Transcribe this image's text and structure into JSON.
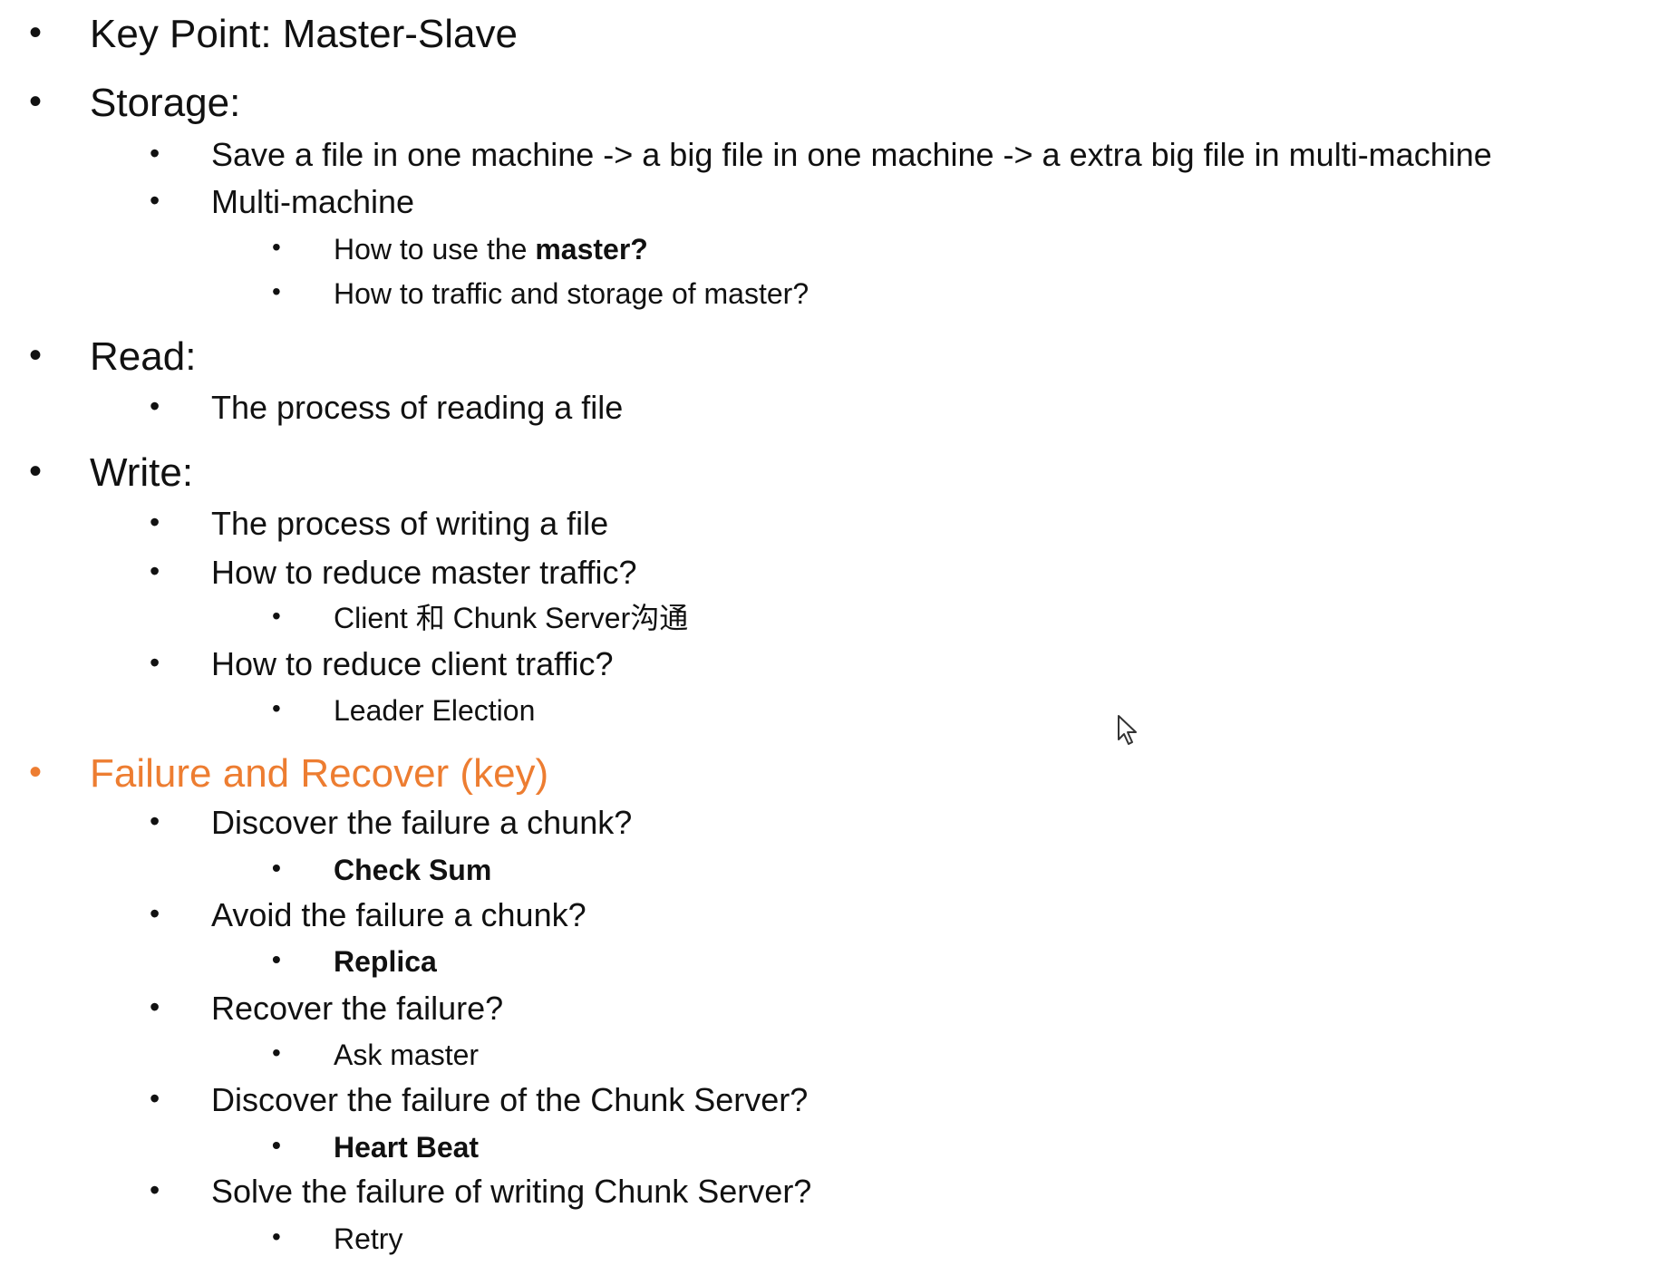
{
  "outline": {
    "key_point": "Key Point: Master-Slave",
    "storage": {
      "heading": "Storage:",
      "save_file": "Save a file in one machine -> a big file in one machine -> a extra big file in multi-machine",
      "multi_machine": "Multi-machine",
      "use_master_prefix": "How to use the ",
      "use_master_bold": "master?",
      "traffic_storage": "How to traffic and storage of master?"
    },
    "read": {
      "heading": "Read:",
      "process": "The process of reading a file"
    },
    "write": {
      "heading": "Write:",
      "process": "The process of writing a file",
      "reduce_master": "How to reduce master traffic?",
      "client_chunk": "Client 和 Chunk Server沟通",
      "reduce_client": "How to reduce client traffic?",
      "leader_election": "Leader Election"
    },
    "failure": {
      "heading": "Failure and Recover (key)",
      "discover_chunk": "Discover the failure a chunk?",
      "check_sum": "Check Sum",
      "avoid_chunk": "Avoid the failure a chunk?",
      "replica": "Replica",
      "recover": "Recover the failure?",
      "ask_master": "Ask master",
      "discover_server": "Discover the failure of the Chunk Server?",
      "heart_beat": "Heart Beat",
      "solve_writing": "Solve the failure of writing Chunk Server?",
      "retry": "Retry"
    }
  },
  "bullet_glyph": "•",
  "accent_color": "#ed7d31",
  "cursor_icon": "mouse-pointer-icon"
}
